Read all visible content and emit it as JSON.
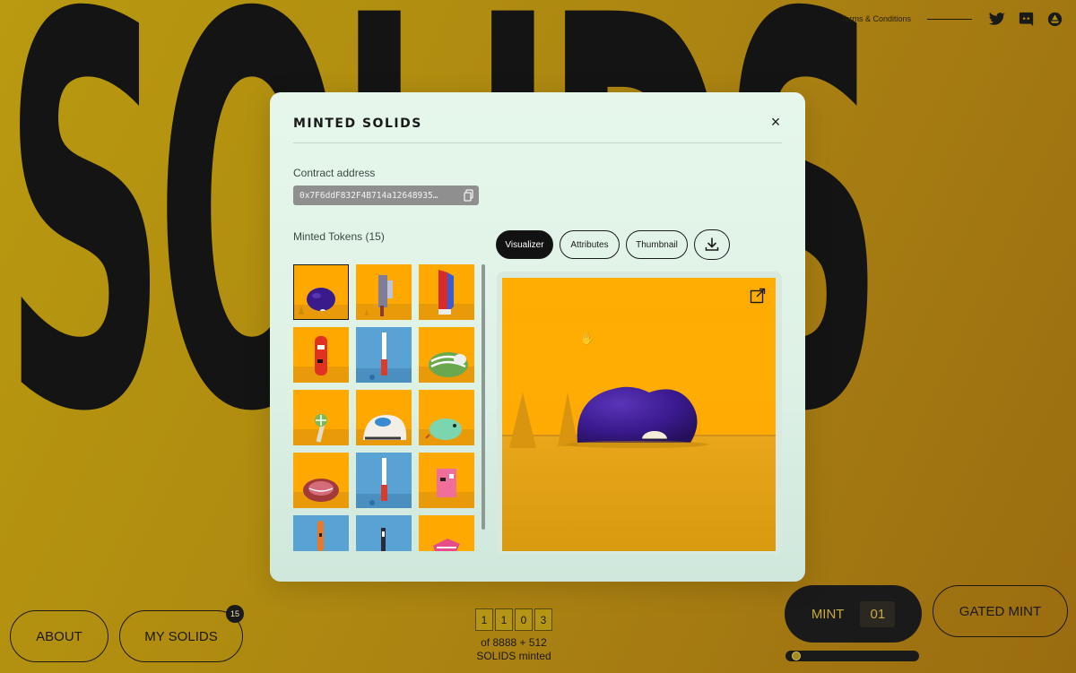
{
  "background": {
    "title": "SOLIDS",
    "colors": {
      "bg": "#b08c10",
      "title": "#141414"
    }
  },
  "topbar": {
    "terms_label": "Terms & Conditions",
    "icons": [
      "twitter-icon",
      "discord-icon",
      "boat-icon"
    ]
  },
  "modal": {
    "title": "MINTED SOLIDS",
    "close_label": "×",
    "contract_label": "Contract address",
    "contract_address": "0x7F6ddF832F4B714a12648935…",
    "tokens_label": "Minted Tokens (15)",
    "tabs": [
      "Visualizer",
      "Attributes",
      "Thumbnail"
    ],
    "active_tab": "Visualizer",
    "tokens": [
      {
        "bg": "orange",
        "object": "purple blob",
        "selected": true
      },
      {
        "bg": "orange",
        "object": "grey block"
      },
      {
        "bg": "orange",
        "object": "red blue shard"
      },
      {
        "bg": "orange",
        "object": "red cylinder"
      },
      {
        "bg": "blue",
        "object": "white red stick"
      },
      {
        "bg": "orange",
        "object": "green striped shell"
      },
      {
        "bg": "orange",
        "object": "swirl stick"
      },
      {
        "bg": "orange",
        "object": "white blue shell"
      },
      {
        "bg": "orange",
        "object": "mint green blob"
      },
      {
        "bg": "orange",
        "object": "patterned rock"
      },
      {
        "bg": "blue",
        "object": "white red stick"
      },
      {
        "bg": "orange",
        "object": "pink cube"
      },
      {
        "bg": "blue",
        "object": "orange cylinder"
      },
      {
        "bg": "blue",
        "object": "dark stick"
      },
      {
        "bg": "orange",
        "object": "pink shard"
      }
    ],
    "colors": {
      "viewer_bg": "#ffab04",
      "blob": "#3a1b8c",
      "accent": "#121212"
    }
  },
  "bottom": {
    "about_label": "ABOUT",
    "my_solids_label": "MY SOLIDS",
    "my_solids_badge": "15",
    "counter_digits": [
      "1",
      "1",
      "0",
      "3"
    ],
    "counter_line1": "of 8888 + 512",
    "counter_line2": "SOLIDS minted",
    "mint_label": "MINT",
    "mint_quantity": "01",
    "mint_progress": 0.04,
    "gated_label": "GATED MINT"
  }
}
